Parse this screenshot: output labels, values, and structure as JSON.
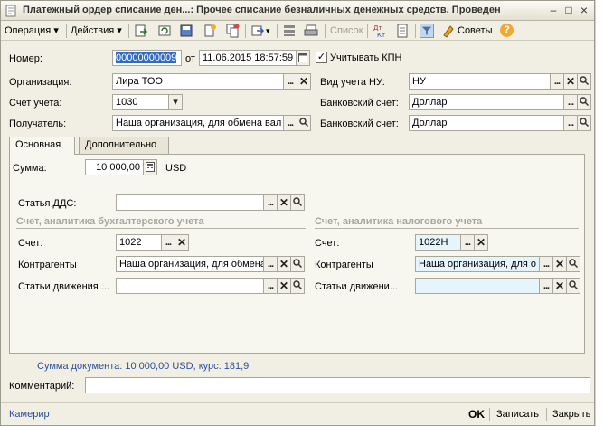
{
  "window": {
    "title": "Платежный ордер списание ден...: Прочее списание безналичных денежных средств. Проведен",
    "buttons": {
      "minimize": "–",
      "maximize": "□",
      "close": "×"
    }
  },
  "toolbar": {
    "operation": "Операция ▾",
    "actions": "Действия ▾",
    "list": "Список",
    "tips": "Советы",
    "help": "?"
  },
  "header": {
    "number_label": "Номер:",
    "number_value": "00000000009",
    "from_label": "от",
    "date_value": "11.06.2015 18:57:59",
    "kpn_label": "Учитывать КПН",
    "kpn_checked": "✓",
    "org_label": "Организация:",
    "org_value": "Лира ТОО",
    "nu_label": "Вид учета НУ:",
    "nu_value": "НУ",
    "account_label": "Счет учета:",
    "account_value": "1030",
    "bank_label_1": "Банковский счет:",
    "bank_value_1": "Доллар",
    "recipient_label": "Получатель:",
    "recipient_value": "Наша организация, для обмена вал",
    "bank_label_2": "Банковский счет:",
    "bank_value_2": "Доллар"
  },
  "tabs": [
    {
      "label": "Основная"
    },
    {
      "label": "Дополнительно"
    }
  ],
  "main": {
    "sum_label": "Сумма:",
    "sum_value": "10 000,00",
    "currency": "USD",
    "dds_label": "Статья ДДС:",
    "dds_value": "",
    "buh_section": "Счет, аналитика бухгалтерского учета",
    "tax_section": "Счет, аналитика налогового учета",
    "buh_account_label": "Счет:",
    "buh_account_value": "1022",
    "buh_contr_label": "Контрагенты",
    "buh_contr_value": "Наша организация, для обмена",
    "buh_move_label": "Статьи движения ...",
    "buh_move_value": "",
    "tax_account_label": "Счет:",
    "tax_account_value": "1022Н",
    "tax_contr_label": "Контрагенты",
    "tax_contr_value": "Наша организация, для о",
    "tax_move_label": "Статьи движени...",
    "tax_move_value": ""
  },
  "summary": "Сумма документа: 10 000,00 USD, курс: 181,9",
  "comment": {
    "label": "Комментарий:",
    "value": ""
  },
  "bottom": {
    "cashier": "Камерир",
    "ok": "OK",
    "save": "Записать",
    "close": "Закрыть"
  }
}
